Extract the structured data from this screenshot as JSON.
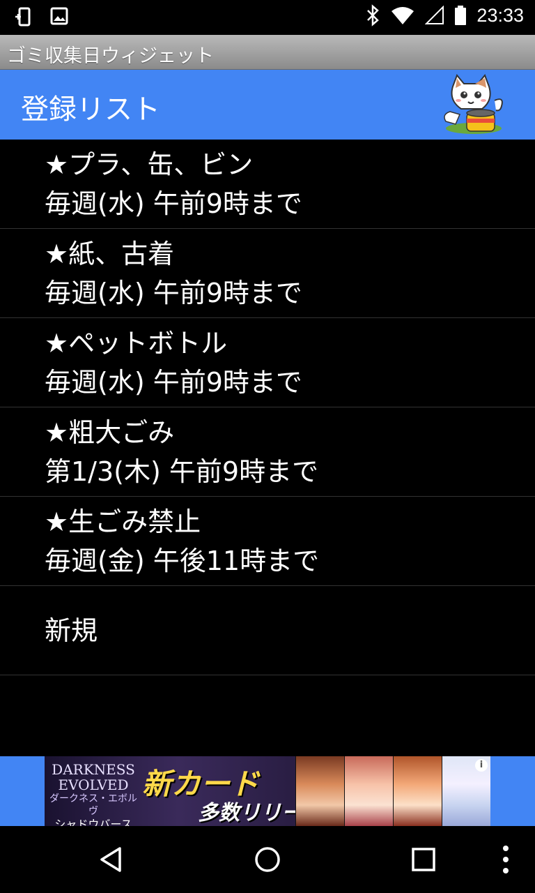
{
  "status_bar": {
    "time": "23:33",
    "icons": [
      "phone-lock-icon",
      "image-icon",
      "bluetooth-icon",
      "wifi-icon",
      "signal-icon",
      "battery-icon"
    ]
  },
  "window": {
    "title": "ゴミ収集日ウィジェット"
  },
  "header": {
    "title": "登録リスト",
    "mascot_icon": "cat-mascot-icon"
  },
  "items": [
    {
      "name": "★プラ、缶、ビン",
      "schedule": "毎週(水) 午前9時まで"
    },
    {
      "name": "★紙、古着",
      "schedule": "毎週(水) 午前9時まで"
    },
    {
      "name": "★ペットボトル",
      "schedule": "毎週(水) 午前9時まで"
    },
    {
      "name": "★粗大ごみ",
      "schedule": "第1/3(木) 午前9時まで"
    },
    {
      "name": "★生ごみ禁止",
      "schedule": "毎週(金) 午後11時まで"
    }
  ],
  "new_item": {
    "label": "新規"
  },
  "ad": {
    "brand_line1": "DARKNESS",
    "brand_line2": "EVOLVED",
    "brand_line3": "ダークネス・エボルヴ",
    "brand_line4": "シャドウバース",
    "headline": "新カード",
    "subline": "多数リリース",
    "info_icon": "i"
  },
  "colors": {
    "accent": "#4285f4",
    "background": "#000000",
    "text": "#ffffff"
  }
}
